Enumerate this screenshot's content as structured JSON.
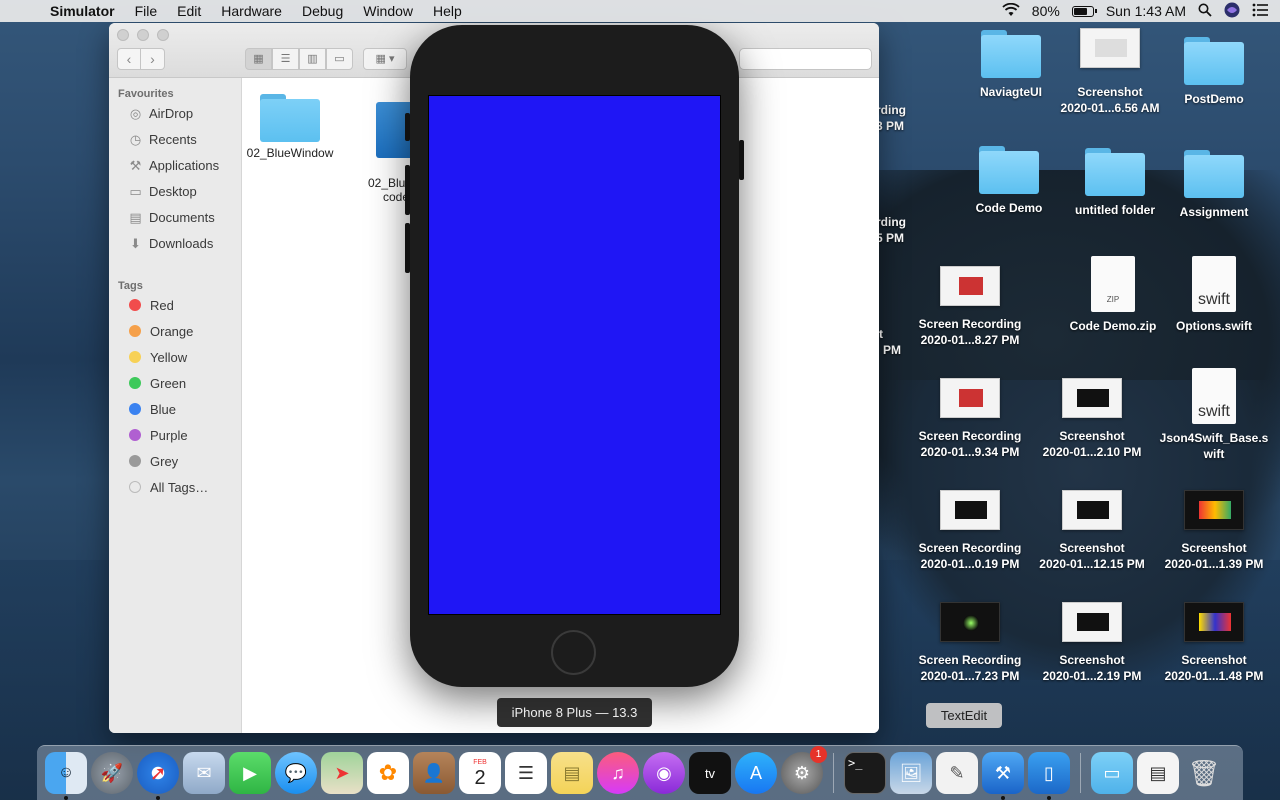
{
  "menubar": {
    "app_name": "Simulator",
    "items": [
      "File",
      "Edit",
      "Hardware",
      "Debug",
      "Window",
      "Help"
    ],
    "battery_percent": "80%",
    "battery_level": 0.8,
    "clock": "Sun 1:43 AM"
  },
  "finder": {
    "sidebar": {
      "favourites_header": "Favourites",
      "favourites": [
        {
          "label": "AirDrop",
          "icon": "airdrop-icon"
        },
        {
          "label": "Recents",
          "icon": "clock-icon"
        },
        {
          "label": "Applications",
          "icon": "applications-icon"
        },
        {
          "label": "Desktop",
          "icon": "desktop-icon"
        },
        {
          "label": "Documents",
          "icon": "document-icon"
        },
        {
          "label": "Downloads",
          "icon": "download-icon"
        }
      ],
      "tags_header": "Tags",
      "tags": [
        {
          "label": "Red",
          "color": "#f14c4c"
        },
        {
          "label": "Orange",
          "color": "#f5a04a"
        },
        {
          "label": "Yellow",
          "color": "#f7d156"
        },
        {
          "label": "Green",
          "color": "#3ec95b"
        },
        {
          "label": "Blue",
          "color": "#3a82f0"
        },
        {
          "label": "Purple",
          "color": "#b05fd1"
        },
        {
          "label": "Grey",
          "color": "#9a9a9a"
        },
        {
          "label": "All Tags…",
          "color": "#e0e0e0"
        }
      ]
    },
    "files": [
      {
        "label": "02_BlueWindow"
      },
      {
        "label": "02_Blue…\ncode"
      }
    ]
  },
  "simulator": {
    "device_label": "iPhone 8 Plus — 13.3",
    "screen_color": "#1f16f5"
  },
  "desktop": {
    "icons": [
      {
        "label": "NaviagteUI"
      },
      {
        "label": "Screenshot\n2020-01...6.56 AM"
      },
      {
        "label": "PostDemo"
      },
      {
        "label": "Code Demo"
      },
      {
        "label": "untitled folder"
      },
      {
        "label": "Assignment"
      },
      {
        "label": "Screen Recording\n2020-01...8.27 PM"
      },
      {
        "label": "Code Demo.zip"
      },
      {
        "label": "Options.swift"
      },
      {
        "label": "Screen Recording\n2020-01...9.34 PM"
      },
      {
        "label": "Screenshot\n2020-01...2.10 PM"
      },
      {
        "label": "Json4Swift_Base.s\nwift"
      },
      {
        "label": "Screen Recording\n2020-01...0.19 PM"
      },
      {
        "label": "Screenshot\n2020-01...12.15 PM"
      },
      {
        "label": "Screenshot\n2020-01...1.39 PM"
      },
      {
        "label": "Screen Recording\n2020-01...7.23 PM"
      },
      {
        "label": "Screenshot\n2020-01...2.19 PM"
      },
      {
        "label": "Screenshot\n2020-01...1.48 PM"
      }
    ],
    "partial_labels": [
      "rding",
      "3 PM",
      "rding",
      "5 PM",
      "t",
      "PM"
    ],
    "zip_badge": "ZIP",
    "swift_badge": "swift"
  },
  "tooltip": "TextEdit",
  "dock": {
    "calendar_month": "FEB",
    "calendar_day": "2",
    "appstore_badge": "1",
    "tv_label": "tv"
  }
}
